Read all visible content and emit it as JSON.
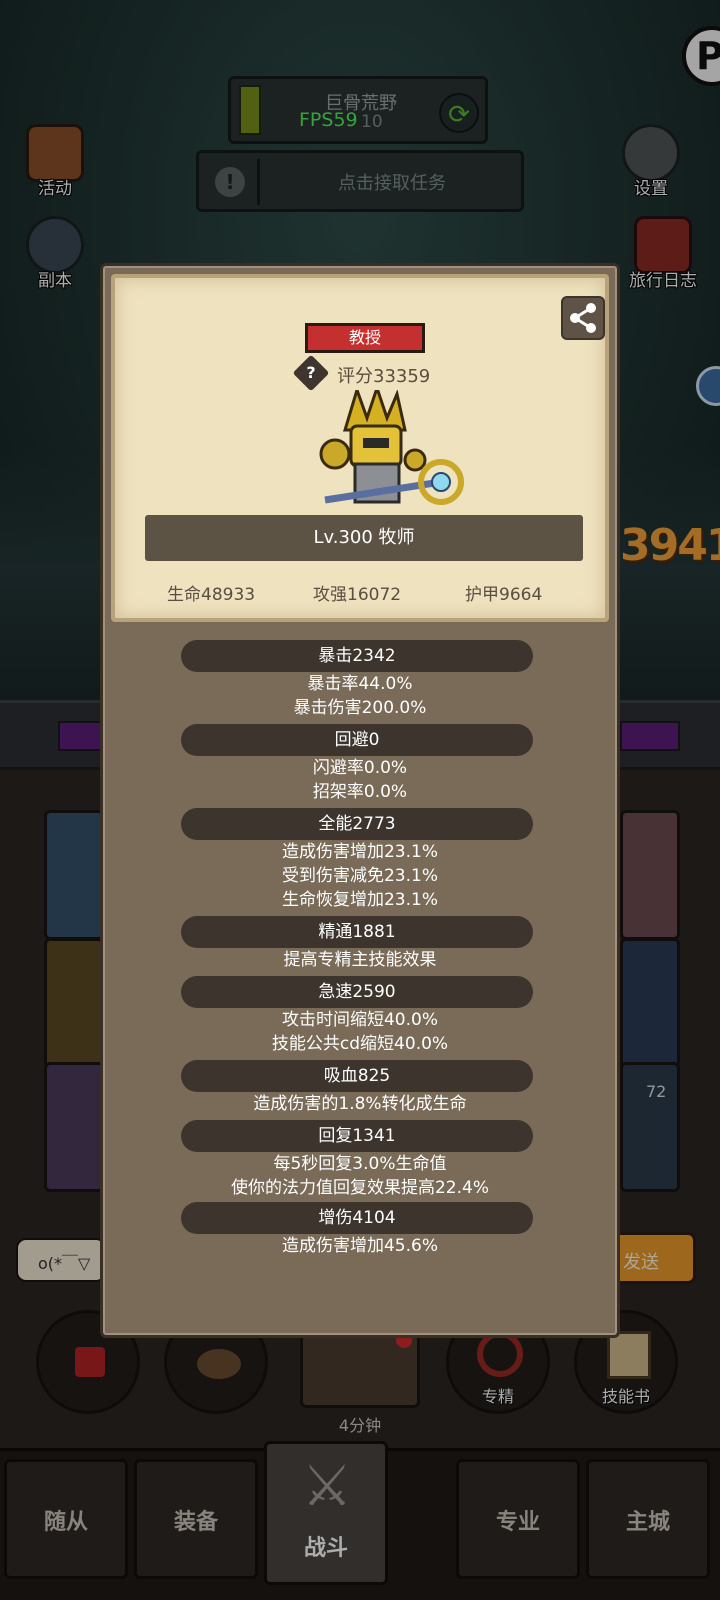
{
  "hud": {
    "zone_name": "巨骨荒野",
    "fps": "FPS59",
    "zone_sub": "10",
    "task_label": "点击接取任务",
    "left_buttons": [
      {
        "label": "活动",
        "icon": "activity-scroll-icon"
      },
      {
        "label": "副本",
        "icon": "dungeon-portal-icon"
      }
    ],
    "right_buttons": [
      {
        "label": "设置",
        "icon": "gear-icon"
      },
      {
        "label": "旅行日志",
        "icon": "journal-book-icon"
      }
    ]
  },
  "background": {
    "damage_number": "3941",
    "count_badge": "72",
    "chat_input": "o(*￣▽",
    "send_label": "发送"
  },
  "dialog": {
    "title_badge": "教授",
    "score": "评分33359",
    "level": "Lv.300 牧师",
    "base_stats": [
      "生命48933",
      "攻强16072",
      "护甲9664"
    ],
    "sections": [
      {
        "header": "暴击2342",
        "lines": [
          "暴击率44.0%",
          "暴击伤害200.0%"
        ]
      },
      {
        "header": "回避0",
        "lines": [
          "闪避率0.0%",
          "招架率0.0%"
        ]
      },
      {
        "header": "全能2773",
        "lines": [
          "造成伤害增加23.1%",
          "受到伤害减免23.1%",
          "生命恢复增加23.1%"
        ]
      },
      {
        "header": "精通1881",
        "lines": [
          "提高专精主技能效果"
        ]
      },
      {
        "header": "急速2590",
        "lines": [
          "攻击时间缩短40.0%",
          "技能公共cd缩短40.0%"
        ]
      },
      {
        "header": "吸血825",
        "lines": [
          "造成伤害的1.8%转化成生命"
        ]
      },
      {
        "header": "回复1341",
        "lines": [
          "每5秒回复3.0%生命值",
          "使你的法力值回复效果提高22.4%"
        ]
      },
      {
        "header": "增伤4104",
        "lines": [
          "造成伤害增加45.6%"
        ]
      }
    ]
  },
  "actions": {
    "chest_time": "4分钟",
    "specialization": "专精",
    "skill_book": "技能书"
  },
  "nav": {
    "tabs": [
      "随从",
      "装备",
      "战斗",
      "专业",
      "主城"
    ]
  },
  "colors": {
    "fps_green": "#4ef05a",
    "badge_red": "#c43030",
    "card_parchment": "#efe2bf",
    "stat_header_bg": "#3d352d"
  }
}
